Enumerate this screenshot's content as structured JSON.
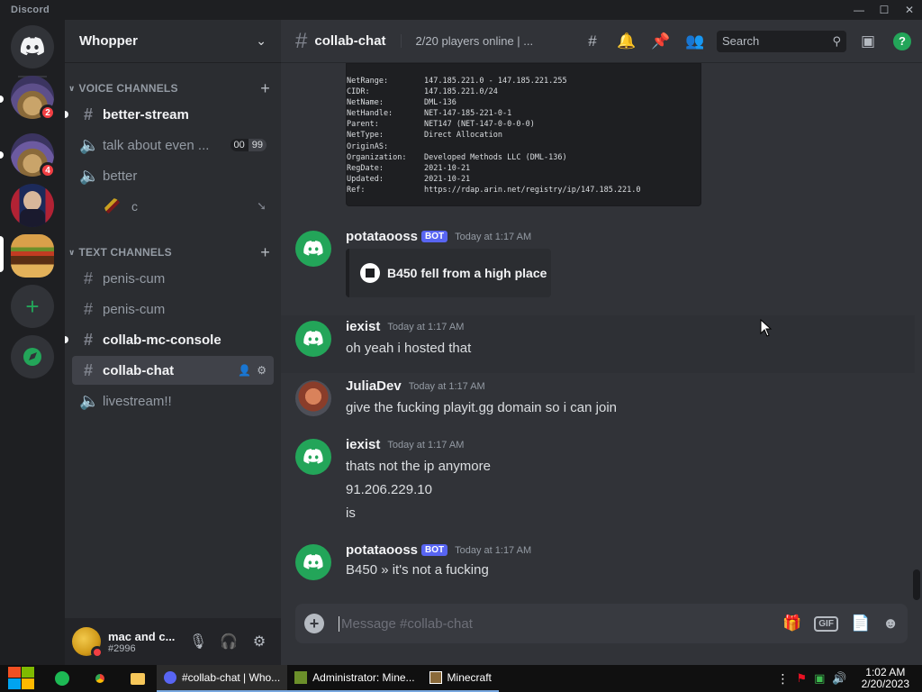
{
  "window": {
    "title": "Discord",
    "controls": [
      "—",
      "☐",
      "✕"
    ]
  },
  "guild": {
    "name": "Whopper"
  },
  "servers": [
    {
      "name": "home",
      "badge": null
    },
    {
      "name": "server-1",
      "badge": "2"
    },
    {
      "name": "server-2",
      "badge": "4"
    },
    {
      "name": "server-3",
      "badge": null
    },
    {
      "name": "server-whopper",
      "badge": null
    }
  ],
  "categories": {
    "voice": "VOICE CHANNELS",
    "text": "TEXT CHANNELS"
  },
  "voice_channels": [
    {
      "name": "better-stream",
      "kind": "text"
    },
    {
      "name": "talk about even ...",
      "kind": "voice",
      "count_a": "00",
      "count_b": "99"
    },
    {
      "name": "better",
      "kind": "voice"
    }
  ],
  "voice_member": {
    "name": "c"
  },
  "text_channels": [
    {
      "name": "penis-cum"
    },
    {
      "name": "penis-cum"
    },
    {
      "name": "collab-mc-console"
    },
    {
      "name": "collab-chat"
    },
    {
      "name": "livestream!!"
    }
  ],
  "user": {
    "name": "mac and c...",
    "tag": "#2996"
  },
  "header": {
    "channel": "collab-chat",
    "topic": "2/20 players online | ...",
    "search_placeholder": "Search"
  },
  "whois": [
    [
      "NetRange:",
      "147.185.221.0 - 147.185.221.255"
    ],
    [
      "CIDR:",
      "147.185.221.0/24"
    ],
    [
      "NetName:",
      "DML-136"
    ],
    [
      "NetHandle:",
      "NET-147-185-221-0-1"
    ],
    [
      "Parent:",
      "NET147 (NET-147-0-0-0-0)"
    ],
    [
      "NetType:",
      "Direct Allocation"
    ],
    [
      "OriginAS:",
      ""
    ],
    [
      "Organization:",
      "Developed Methods LLC (DML-136)"
    ],
    [
      "RegDate:",
      "2021-10-21"
    ],
    [
      "Updated:",
      "2021-10-21"
    ],
    [
      "Ref:",
      "https://rdap.arin.net/registry/ip/147.185.221.0"
    ]
  ],
  "messages": [
    {
      "author": "potataooss",
      "bot": "BOT",
      "time": "Today at 1:17 AM",
      "embed": "B450 fell from a high place"
    },
    {
      "author": "iexist",
      "time": "Today at 1:17 AM",
      "lines": [
        "oh yeah i hosted that"
      ]
    },
    {
      "author": "JuliaDev",
      "time": "Today at 1:17 AM",
      "lines": [
        "give the fucking playit.gg domain so i can join"
      ]
    },
    {
      "author": "iexist",
      "time": "Today at 1:17 AM",
      "lines": [
        "thats not the ip anymore",
        "91.206.229.10",
        "is"
      ]
    },
    {
      "author": "potataooss",
      "bot": "BOT",
      "time": "Today at 1:17 AM",
      "lines": [
        "B450 » it's not a fucking"
      ]
    }
  ],
  "composer": {
    "placeholder": "Message #collab-chat",
    "gif": "GIF"
  },
  "taskbar": {
    "tasks": [
      "#collab-chat | Who...",
      "Administrator: Mine...",
      "Minecraft"
    ],
    "time": "1:02 AM",
    "date": "2/20/2023"
  },
  "colors": {
    "blurple": "#5865f2",
    "green": "#23a559",
    "red": "#f23f43"
  }
}
